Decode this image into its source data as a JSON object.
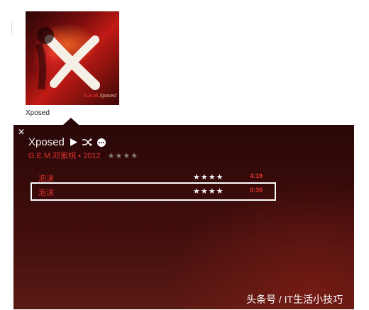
{
  "album_card": {
    "caption": "Xposed",
    "cover_brand": "G.E.M.",
    "cover_title": "Xposed"
  },
  "panel": {
    "close_icon": "close-icon",
    "album_title": "Xposed",
    "controls": [
      "play-icon",
      "shuffle-icon",
      "more-icon"
    ],
    "artist_year": "G.E.M.邓紫棋 • 2012",
    "album_rating": "★★★★",
    "tracks": [
      {
        "title": "泡沫",
        "rating": "★★★★",
        "duration": "4:19"
      },
      {
        "title": "泡沫",
        "rating": "★★★★",
        "duration": "0:30"
      }
    ]
  },
  "watermark": "头条号 / IT生活小技巧",
  "colors": {
    "panel_bg": "#3a0b0b",
    "accent_red": "#d8322d",
    "highlight_box": "#ffffff"
  }
}
